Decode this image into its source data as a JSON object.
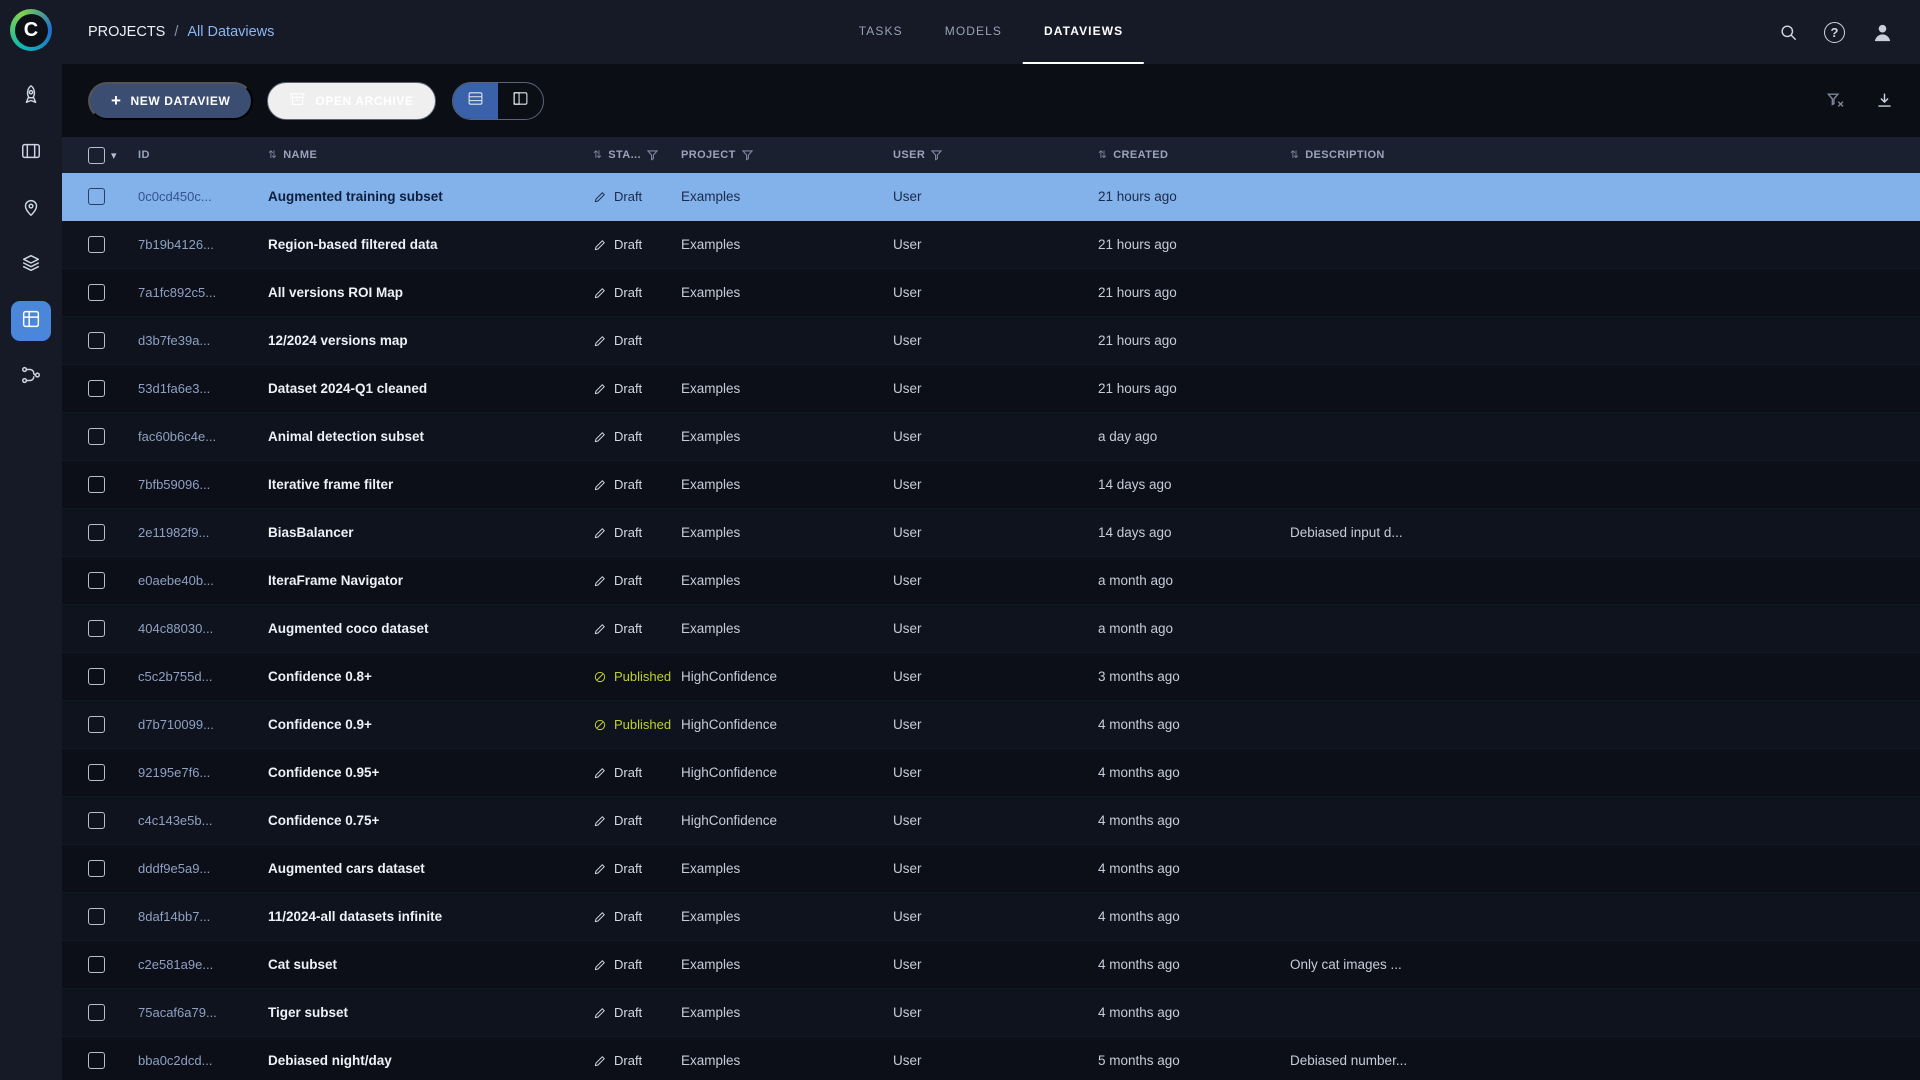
{
  "brand": {
    "logo_letter": "C"
  },
  "glyphs": {
    "plus": "+",
    "caret_down": "▾",
    "sort": "⇅",
    "help": "?"
  },
  "sidebar": {
    "items": [
      {
        "icon": "projects-icon",
        "active": false
      },
      {
        "icon": "datasets-icon",
        "active": false
      },
      {
        "icon": "annotations-icon",
        "active": false
      },
      {
        "icon": "hyperdatasets-icon",
        "active": false
      },
      {
        "icon": "dataviews-icon",
        "active": true
      },
      {
        "icon": "pipelines-icon",
        "active": false
      }
    ]
  },
  "header": {
    "breadcrumb": {
      "root": "PROJECTS",
      "separator": "/",
      "current": "All Dataviews"
    },
    "tabs": [
      {
        "label": "TASKS",
        "active": false
      },
      {
        "label": "MODELS",
        "active": false
      },
      {
        "label": "DATAVIEWS",
        "active": true
      }
    ],
    "icons": [
      "search-icon",
      "help-icon",
      "user-avatar"
    ]
  },
  "toolbar": {
    "new_dataview_label": "NEW DATAVIEW",
    "open_archive_label": "OPEN ARCHIVE",
    "view_toggle": [
      "table-view",
      "card-view"
    ],
    "right_icons": [
      "clear-filters-icon",
      "download-icon"
    ]
  },
  "table": {
    "columns": [
      {
        "key": "id",
        "label": "ID",
        "sortable": false,
        "filterable": false
      },
      {
        "key": "name",
        "label": "NAME",
        "sortable": true,
        "filterable": false
      },
      {
        "key": "status",
        "label": "STA...",
        "sortable": true,
        "filterable": true
      },
      {
        "key": "project",
        "label": "PROJECT",
        "sortable": false,
        "filterable": true
      },
      {
        "key": "user",
        "label": "USER",
        "sortable": false,
        "filterable": true
      },
      {
        "key": "created",
        "label": "CREATED",
        "sortable": true,
        "filterable": false
      },
      {
        "key": "description",
        "label": "DESCRIPTION",
        "sortable": true,
        "filterable": false
      }
    ],
    "status_labels": {
      "draft": "Draft",
      "published": "Published"
    },
    "rows": [
      {
        "id": "0c0cd450c...",
        "name": "Augmented training subset",
        "status": "draft",
        "project": "Examples",
        "user": "User",
        "created": "21 hours ago",
        "description": "",
        "selected": true
      },
      {
        "id": "7b19b4126...",
        "name": "Region-based filtered data",
        "status": "draft",
        "project": "Examples",
        "user": "User",
        "created": "21 hours ago",
        "description": "",
        "selected": false
      },
      {
        "id": "7a1fc892c5...",
        "name": "All versions ROI Map",
        "status": "draft",
        "project": "Examples",
        "user": "User",
        "created": "21 hours ago",
        "description": "",
        "selected": false
      },
      {
        "id": "d3b7fe39a...",
        "name": "12/2024 versions map",
        "status": "draft",
        "project": "",
        "user": "User",
        "created": "21 hours ago",
        "description": "",
        "selected": false
      },
      {
        "id": "53d1fa6e3...",
        "name": "Dataset 2024-Q1 cleaned",
        "status": "draft",
        "project": "Examples",
        "user": "User",
        "created": "21 hours ago",
        "description": "",
        "selected": false
      },
      {
        "id": "fac60b6c4e...",
        "name": "Animal detection subset",
        "status": "draft",
        "project": "Examples",
        "user": "User",
        "created": "a day ago",
        "description": "",
        "selected": false
      },
      {
        "id": "7bfb59096...",
        "name": "Iterative frame filter",
        "status": "draft",
        "project": "Examples",
        "user": "User",
        "created": "14 days ago",
        "description": "",
        "selected": false
      },
      {
        "id": "2e11982f9...",
        "name": "BiasBalancer",
        "status": "draft",
        "project": "Examples",
        "user": "User",
        "created": "14 days ago",
        "description": "Debiased input d...",
        "selected": false
      },
      {
        "id": "e0aebe40b...",
        "name": "IteraFrame Navigator",
        "status": "draft",
        "project": "Examples",
        "user": "User",
        "created": "a month ago",
        "description": "",
        "selected": false
      },
      {
        "id": "404c88030...",
        "name": "Augmented coco dataset",
        "status": "draft",
        "project": "Examples",
        "user": "User",
        "created": "a month ago",
        "description": "",
        "selected": false
      },
      {
        "id": "c5c2b755d...",
        "name": "Confidence 0.8+",
        "status": "published",
        "project": "HighConfidence",
        "user": "User",
        "created": "3 months ago",
        "description": "",
        "selected": false
      },
      {
        "id": "d7b710099...",
        "name": "Confidence 0.9+",
        "status": "published",
        "project": "HighConfidence",
        "user": "User",
        "created": "4 months ago",
        "description": "",
        "selected": false
      },
      {
        "id": "92195e7f6...",
        "name": "Confidence 0.95+",
        "status": "draft",
        "project": "HighConfidence",
        "user": "User",
        "created": "4 months ago",
        "description": "",
        "selected": false
      },
      {
        "id": "c4c143e5b...",
        "name": "Confidence 0.75+",
        "status": "draft",
        "project": "HighConfidence",
        "user": "User",
        "created": "4 months ago",
        "description": "",
        "selected": false
      },
      {
        "id": "dddf9e5a9...",
        "name": "Augmented cars dataset",
        "status": "draft",
        "project": "Examples",
        "user": "User",
        "created": "4 months ago",
        "description": "",
        "selected": false
      },
      {
        "id": "8daf14bb7...",
        "name": "11/2024-all datasets infinite",
        "status": "draft",
        "project": "Examples",
        "user": "User",
        "created": "4 months ago",
        "description": "",
        "selected": false
      },
      {
        "id": "c2e581a9e...",
        "name": "Cat subset",
        "status": "draft",
        "project": "Examples",
        "user": "User",
        "created": "4 months ago",
        "description": "Only cat images ...",
        "selected": false
      },
      {
        "id": "75acaf6a79...",
        "name": "Tiger subset",
        "status": "draft",
        "project": "Examples",
        "user": "User",
        "created": "4 months ago",
        "description": "",
        "selected": false
      },
      {
        "id": "bba0c2dcd...",
        "name": "Debiased night/day",
        "status": "draft",
        "project": "Examples",
        "user": "User",
        "created": "5 months ago",
        "description": "Debiased number...",
        "selected": false
      }
    ]
  },
  "colors": {
    "accent_blue": "#4a86d9",
    "selected_row": "#83b1ea",
    "published": "#bfd02e",
    "link_blue": "#8cb5f0",
    "topbar_bg": "#151a26",
    "page_bg": "#0b0e15"
  }
}
